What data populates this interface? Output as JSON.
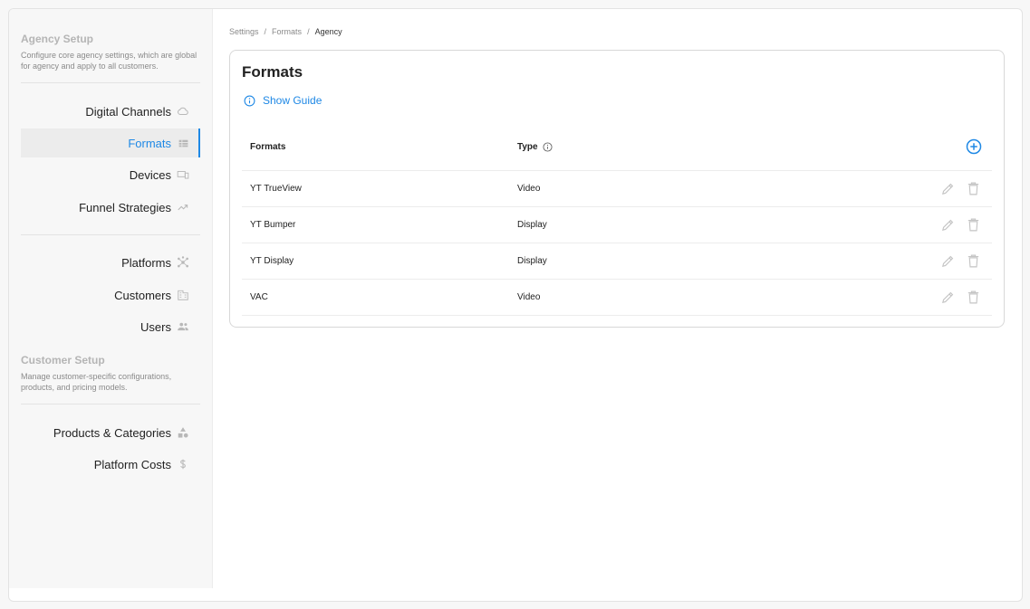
{
  "sidebar": {
    "agency_setup": {
      "title": "Agency Setup",
      "description": "Configure core agency settings, which are global for agency and apply to all customers."
    },
    "agency_items": [
      {
        "label": "Digital Channels",
        "icon": "cloud-icon"
      },
      {
        "label": "Formats",
        "icon": "table-icon",
        "active": true
      },
      {
        "label": "Devices",
        "icon": "devices-icon"
      },
      {
        "label": "Funnel Strategies",
        "icon": "trending-up-icon"
      }
    ],
    "agency_items_2": [
      {
        "label": "Platforms",
        "icon": "hub-icon"
      },
      {
        "label": "Customers",
        "icon": "building-icon"
      },
      {
        "label": "Users",
        "icon": "people-icon"
      }
    ],
    "customer_setup": {
      "title": "Customer Setup",
      "description": "Manage customer-specific configurations, products, and pricing models."
    },
    "customer_items": [
      {
        "label": "Products & Categories",
        "icon": "category-icon"
      },
      {
        "label": "Platform Costs",
        "icon": "dollar-icon"
      }
    ]
  },
  "breadcrumb": [
    "Settings",
    "Formats",
    "Agency"
  ],
  "main": {
    "title": "Formats",
    "show_guide": "Show Guide",
    "columns": {
      "name": "Formats",
      "type": "Type"
    },
    "rows": [
      {
        "name": "YT TrueView",
        "type": "Video"
      },
      {
        "name": "YT Bumper",
        "type": "Display"
      },
      {
        "name": "YT Display",
        "type": "Display"
      },
      {
        "name": "VAC",
        "type": "Video"
      }
    ]
  },
  "colors": {
    "accent": "#1e88e5",
    "muted_icon": "#c4c4c4"
  }
}
